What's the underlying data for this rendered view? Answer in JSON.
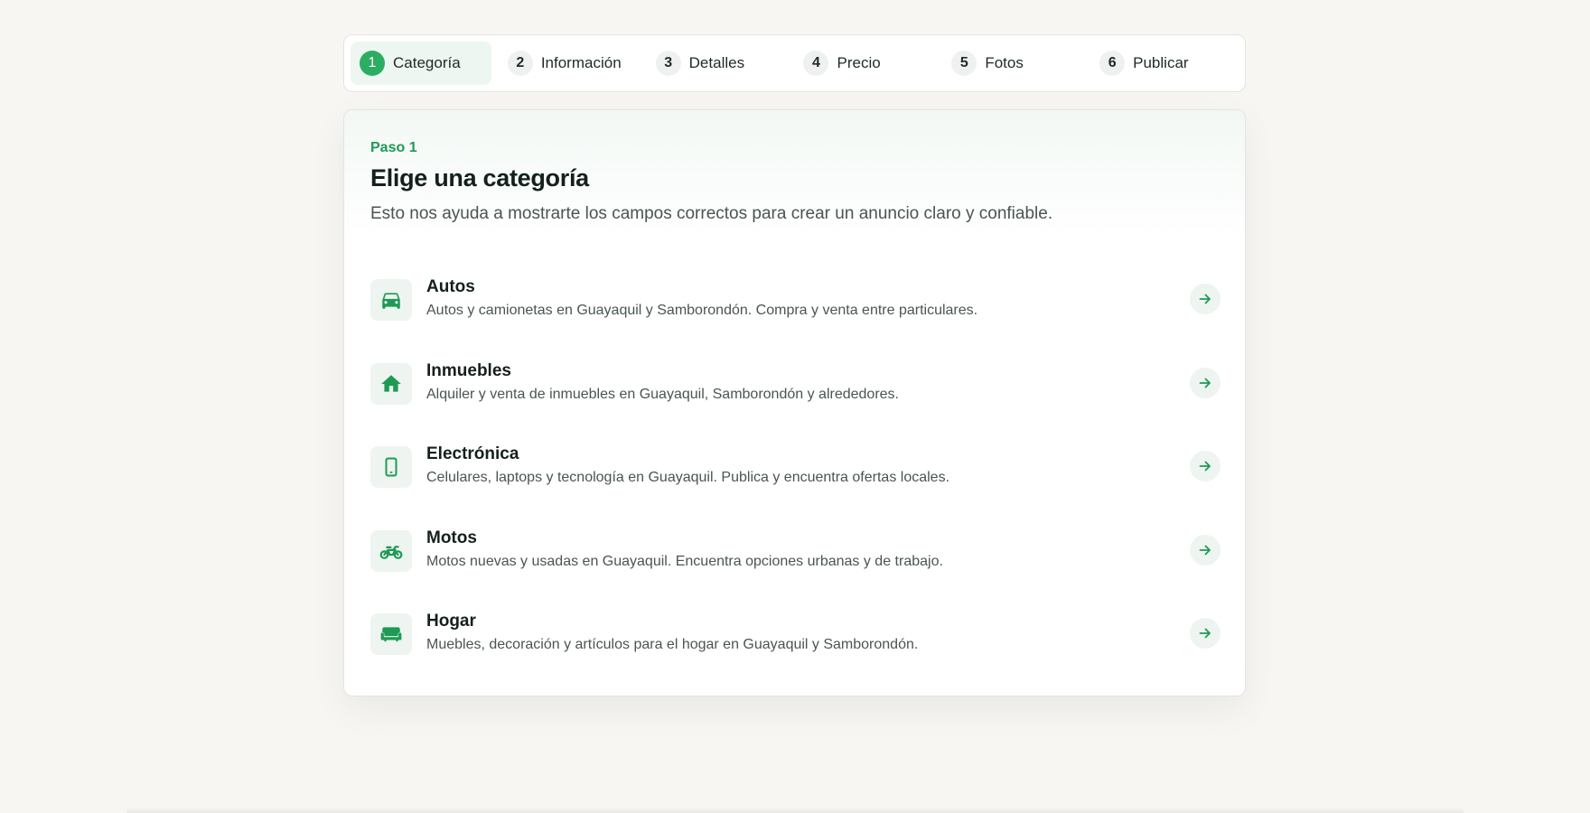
{
  "stepper": {
    "steps": [
      {
        "number": "1",
        "label": "Categoría",
        "active": true
      },
      {
        "number": "2",
        "label": "Información",
        "active": false
      },
      {
        "number": "3",
        "label": "Detalles",
        "active": false
      },
      {
        "number": "4",
        "label": "Precio",
        "active": false
      },
      {
        "number": "5",
        "label": "Fotos",
        "active": false
      },
      {
        "number": "6",
        "label": "Publicar",
        "active": false
      }
    ]
  },
  "card": {
    "eyebrow": "Paso 1",
    "title": "Elige una categoría",
    "subtitle": "Esto nos ayuda a mostrarte los campos correctos para crear un anuncio claro y confiable."
  },
  "categories": [
    {
      "name": "Autos",
      "description": "Autos y camionetas en Guayaquil y Samborondón. Compra y venta entre particulares.",
      "icon": "car-icon"
    },
    {
      "name": "Inmuebles",
      "description": "Alquiler y venta de inmuebles en Guayaquil, Samborondón y alrededores.",
      "icon": "house-icon"
    },
    {
      "name": "Electrónica",
      "description": "Celulares, laptops y tecnología en Guayaquil. Publica y encuentra ofertas locales.",
      "icon": "phone-icon"
    },
    {
      "name": "Motos",
      "description": "Motos nuevas y usadas en Guayaquil. Encuentra opciones urbanas y de trabajo.",
      "icon": "motorcycle-icon"
    },
    {
      "name": "Hogar",
      "description": "Muebles, decoración y artículos para el hogar en Guayaquil y Samborondón.",
      "icon": "sofa-icon"
    }
  ],
  "colors": {
    "accent": "#2bae61",
    "accent_text": "#1f9a54",
    "page_bg": "#f7f6f3"
  }
}
